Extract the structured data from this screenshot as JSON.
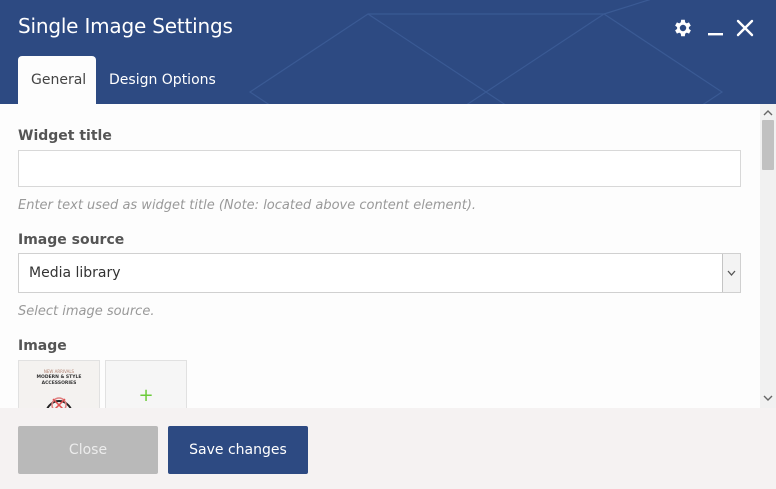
{
  "window": {
    "title": "Single Image Settings"
  },
  "header": {
    "icons": [
      "gear-icon",
      "minimize-icon",
      "close-icon"
    ],
    "tabs": [
      {
        "label": "General",
        "active": true
      },
      {
        "label": "Design Options",
        "active": false
      }
    ]
  },
  "form": {
    "widget_title": {
      "label": "Widget title",
      "value": "",
      "hint": "Enter text used as widget title (Note: located above content element)."
    },
    "image_source": {
      "label": "Image source",
      "selected": "Media library",
      "hint": "Select image source."
    },
    "image": {
      "label": "Image",
      "thumbnail": {
        "line1": "NEW ARRIVALS",
        "line2": "MODERN & STYLE",
        "line3": "ACCESSORIES"
      },
      "add_glyph": "+"
    }
  },
  "footer": {
    "close_label": "Close",
    "save_label": "Save changes"
  },
  "colors": {
    "header_bg": "#2d4a82",
    "save_bg": "#2d4a82",
    "close_bg": "#b9b9b9",
    "add_plus": "#6ccb3a"
  }
}
